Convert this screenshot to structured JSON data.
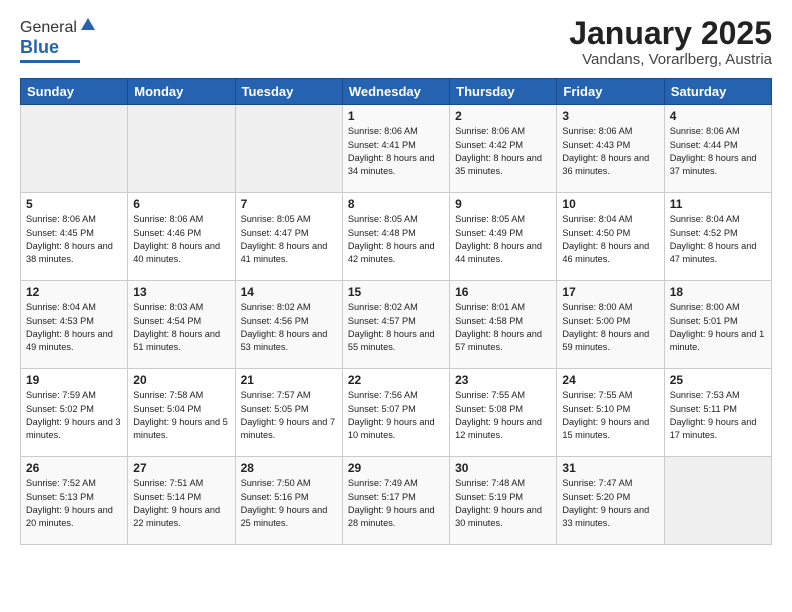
{
  "logo": {
    "general": "General",
    "blue": "Blue"
  },
  "header": {
    "month": "January 2025",
    "location": "Vandans, Vorarlberg, Austria"
  },
  "weekdays": [
    "Sunday",
    "Monday",
    "Tuesday",
    "Wednesday",
    "Thursday",
    "Friday",
    "Saturday"
  ],
  "weeks": [
    [
      {
        "day": "",
        "info": ""
      },
      {
        "day": "",
        "info": ""
      },
      {
        "day": "",
        "info": ""
      },
      {
        "day": "1",
        "info": "Sunrise: 8:06 AM\nSunset: 4:41 PM\nDaylight: 8 hours\nand 34 minutes."
      },
      {
        "day": "2",
        "info": "Sunrise: 8:06 AM\nSunset: 4:42 PM\nDaylight: 8 hours\nand 35 minutes."
      },
      {
        "day": "3",
        "info": "Sunrise: 8:06 AM\nSunset: 4:43 PM\nDaylight: 8 hours\nand 36 minutes."
      },
      {
        "day": "4",
        "info": "Sunrise: 8:06 AM\nSunset: 4:44 PM\nDaylight: 8 hours\nand 37 minutes."
      }
    ],
    [
      {
        "day": "5",
        "info": "Sunrise: 8:06 AM\nSunset: 4:45 PM\nDaylight: 8 hours\nand 38 minutes."
      },
      {
        "day": "6",
        "info": "Sunrise: 8:06 AM\nSunset: 4:46 PM\nDaylight: 8 hours\nand 40 minutes."
      },
      {
        "day": "7",
        "info": "Sunrise: 8:05 AM\nSunset: 4:47 PM\nDaylight: 8 hours\nand 41 minutes."
      },
      {
        "day": "8",
        "info": "Sunrise: 8:05 AM\nSunset: 4:48 PM\nDaylight: 8 hours\nand 42 minutes."
      },
      {
        "day": "9",
        "info": "Sunrise: 8:05 AM\nSunset: 4:49 PM\nDaylight: 8 hours\nand 44 minutes."
      },
      {
        "day": "10",
        "info": "Sunrise: 8:04 AM\nSunset: 4:50 PM\nDaylight: 8 hours\nand 46 minutes."
      },
      {
        "day": "11",
        "info": "Sunrise: 8:04 AM\nSunset: 4:52 PM\nDaylight: 8 hours\nand 47 minutes."
      }
    ],
    [
      {
        "day": "12",
        "info": "Sunrise: 8:04 AM\nSunset: 4:53 PM\nDaylight: 8 hours\nand 49 minutes."
      },
      {
        "day": "13",
        "info": "Sunrise: 8:03 AM\nSunset: 4:54 PM\nDaylight: 8 hours\nand 51 minutes."
      },
      {
        "day": "14",
        "info": "Sunrise: 8:02 AM\nSunset: 4:56 PM\nDaylight: 8 hours\nand 53 minutes."
      },
      {
        "day": "15",
        "info": "Sunrise: 8:02 AM\nSunset: 4:57 PM\nDaylight: 8 hours\nand 55 minutes."
      },
      {
        "day": "16",
        "info": "Sunrise: 8:01 AM\nSunset: 4:58 PM\nDaylight: 8 hours\nand 57 minutes."
      },
      {
        "day": "17",
        "info": "Sunrise: 8:00 AM\nSunset: 5:00 PM\nDaylight: 8 hours\nand 59 minutes."
      },
      {
        "day": "18",
        "info": "Sunrise: 8:00 AM\nSunset: 5:01 PM\nDaylight: 9 hours\nand 1 minute."
      }
    ],
    [
      {
        "day": "19",
        "info": "Sunrise: 7:59 AM\nSunset: 5:02 PM\nDaylight: 9 hours\nand 3 minutes."
      },
      {
        "day": "20",
        "info": "Sunrise: 7:58 AM\nSunset: 5:04 PM\nDaylight: 9 hours\nand 5 minutes."
      },
      {
        "day": "21",
        "info": "Sunrise: 7:57 AM\nSunset: 5:05 PM\nDaylight: 9 hours\nand 7 minutes."
      },
      {
        "day": "22",
        "info": "Sunrise: 7:56 AM\nSunset: 5:07 PM\nDaylight: 9 hours\nand 10 minutes."
      },
      {
        "day": "23",
        "info": "Sunrise: 7:55 AM\nSunset: 5:08 PM\nDaylight: 9 hours\nand 12 minutes."
      },
      {
        "day": "24",
        "info": "Sunrise: 7:55 AM\nSunset: 5:10 PM\nDaylight: 9 hours\nand 15 minutes."
      },
      {
        "day": "25",
        "info": "Sunrise: 7:53 AM\nSunset: 5:11 PM\nDaylight: 9 hours\nand 17 minutes."
      }
    ],
    [
      {
        "day": "26",
        "info": "Sunrise: 7:52 AM\nSunset: 5:13 PM\nDaylight: 9 hours\nand 20 minutes."
      },
      {
        "day": "27",
        "info": "Sunrise: 7:51 AM\nSunset: 5:14 PM\nDaylight: 9 hours\nand 22 minutes."
      },
      {
        "day": "28",
        "info": "Sunrise: 7:50 AM\nSunset: 5:16 PM\nDaylight: 9 hours\nand 25 minutes."
      },
      {
        "day": "29",
        "info": "Sunrise: 7:49 AM\nSunset: 5:17 PM\nDaylight: 9 hours\nand 28 minutes."
      },
      {
        "day": "30",
        "info": "Sunrise: 7:48 AM\nSunset: 5:19 PM\nDaylight: 9 hours\nand 30 minutes."
      },
      {
        "day": "31",
        "info": "Sunrise: 7:47 AM\nSunset: 5:20 PM\nDaylight: 9 hours\nand 33 minutes."
      },
      {
        "day": "",
        "info": ""
      }
    ]
  ]
}
